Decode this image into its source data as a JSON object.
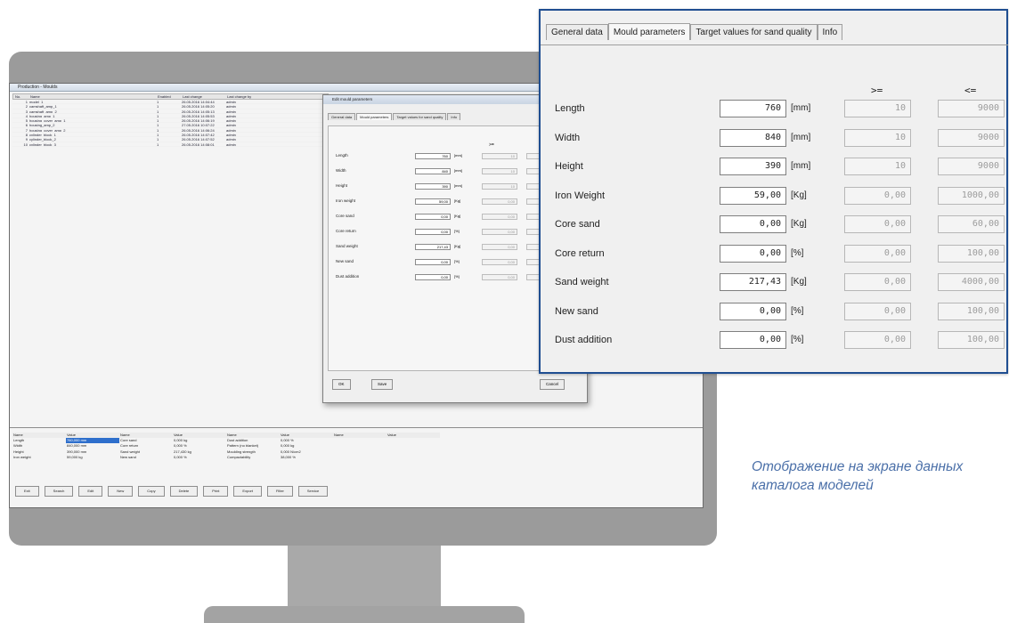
{
  "zoom": {
    "tabs": [
      {
        "label": "General data",
        "active": false
      },
      {
        "label": "Mould parameters",
        "active": true
      },
      {
        "label": "Target values for sand quality",
        "active": false
      },
      {
        "label": "Info",
        "active": false
      }
    ],
    "op_ge": ">=",
    "op_le": "<=",
    "rows": [
      {
        "label": "Length",
        "value": "760",
        "unit": "[mm]",
        "min": "10",
        "max": "9000"
      },
      {
        "label": "Width",
        "value": "840",
        "unit": "[mm]",
        "min": "10",
        "max": "9000"
      },
      {
        "label": "Height",
        "value": "390",
        "unit": "[mm]",
        "min": "10",
        "max": "9000"
      },
      {
        "label": "Iron Weight",
        "value": "59,00",
        "unit": "[Kg]",
        "min": "0,00",
        "max": "1000,00"
      },
      {
        "label": "Core sand",
        "value": "0,00",
        "unit": "[Kg]",
        "min": "0,00",
        "max": "60,00"
      },
      {
        "label": "Core return",
        "value": "0,00",
        "unit": "[%]",
        "min": "0,00",
        "max": "100,00"
      },
      {
        "label": "Sand weight",
        "value": "217,43",
        "unit": "[Kg]",
        "min": "0,00",
        "max": "4000,00"
      },
      {
        "label": "New sand",
        "value": "0,00",
        "unit": "[%]",
        "min": "0,00",
        "max": "100,00"
      },
      {
        "label": "Dust addition",
        "value": "0,00",
        "unit": "[%]",
        "min": "0,00",
        "max": "100,00"
      }
    ]
  },
  "screen": {
    "window_title": "Production - Moulds",
    "columns": [
      "No.",
      "Name",
      "Enabled",
      "Last change",
      "Last change by"
    ],
    "rows": [
      [
        "1",
        "model_1",
        "1",
        "26.05.2016 14:04:44",
        "admin"
      ],
      [
        "2",
        "camshaft_amp_1",
        "1",
        "26.05.2016 14:05:20",
        "admin"
      ],
      [
        "3",
        "camshaft_amp_2",
        "1",
        "26.05.2016 14:05:13",
        "admin"
      ],
      [
        "4",
        "housing_amp_1",
        "1",
        "26.05.2016 14:05:53",
        "admin"
      ],
      [
        "5",
        "housing_cover_amp_1",
        "1",
        "26.05.2016 14:06:19",
        "admin"
      ],
      [
        "6",
        "housing_amp_2",
        "1",
        "27.05.2016 10:07:22",
        "admin"
      ],
      [
        "7",
        "housing_cover_amp_2",
        "1",
        "26.05.2016 14:06:24",
        "admin"
      ],
      [
        "8",
        "cylinder_block_1",
        "1",
        "26.05.2016 14:07:42",
        "admin"
      ],
      [
        "9",
        "cylinder_block_2",
        "1",
        "26.05.2016 14:07:52",
        "admin"
      ],
      [
        "10",
        "cylinder_block_3",
        "1",
        "26.05.2016 14:08:01",
        "admin"
      ]
    ],
    "dialog_title": "Edit mould parameters",
    "dialog_tabs": [
      "General data",
      "Mould parameters",
      "Target values for sand quality",
      "Info"
    ],
    "dialog_rows": [
      {
        "label": "Length",
        "value": "760",
        "unit": "[mm]",
        "min": "10"
      },
      {
        "label": "Width",
        "value": "840",
        "unit": "[mm]",
        "min": "10"
      },
      {
        "label": "Height",
        "value": "390",
        "unit": "[mm]",
        "min": "10"
      },
      {
        "label": "Iron weight",
        "value": "59,00",
        "unit": "[Kg]",
        "min": "0,00"
      },
      {
        "label": "Core sand",
        "value": "0,00",
        "unit": "[Kg]",
        "min": "0,00"
      },
      {
        "label": "Core return",
        "value": "0,00",
        "unit": "[%]",
        "min": "0,00"
      },
      {
        "label": "Sand weight",
        "value": "217,43",
        "unit": "[Kg]",
        "min": "0,00"
      },
      {
        "label": "New sand",
        "value": "0,00",
        "unit": "[%]",
        "min": "0,00"
      },
      {
        "label": "Dust addition",
        "value": "0,00",
        "unit": "[%]",
        "min": "0,00"
      }
    ],
    "dialog_buttons": {
      "ok": "OK",
      "save": "Save",
      "cancel": "Cancel"
    },
    "info_header": [
      "Name",
      "Value",
      "Name",
      "Value",
      "Name",
      "Value",
      "Name",
      "Value"
    ],
    "info_rows": [
      [
        "Length",
        "760,000 mm",
        "Core sand",
        "0,000 kg",
        "Dust addition",
        "0,000 %",
        "",
        ""
      ],
      [
        "Width",
        "840,000 mm",
        "Core return",
        "0,000 %",
        "Pattern (no blanket)",
        "0,000 kg",
        "",
        ""
      ],
      [
        "Height",
        "390,000 mm",
        "Sand weight",
        "217,430 kg",
        "Moulding strength",
        "0,000 N/cm2",
        "",
        ""
      ],
      [
        "Iron weight",
        "59,000 kg",
        "New sand",
        "0,000 %",
        "Compactability",
        "38,000 %",
        "",
        ""
      ]
    ],
    "toolbar": [
      "Exit",
      "Search",
      "Edit",
      "New",
      "Copy",
      "Delete",
      "Print",
      "Export",
      "Filter",
      "Service"
    ]
  },
  "caption": "Отображение на экране данных каталога моделей",
  "colors": {
    "frame": "#1f4e91",
    "caption": "#4a6fa8",
    "monitor": "#9b9b9b",
    "highlight": "#2e6fcc"
  }
}
